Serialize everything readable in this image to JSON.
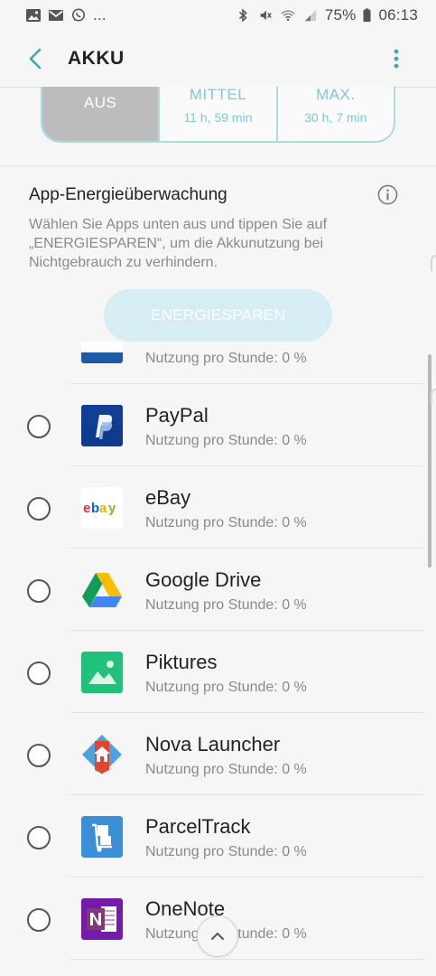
{
  "status_bar": {
    "left_icons": [
      "gallery-icon",
      "gmail-icon",
      "whatsapp-icon"
    ],
    "ellipsis": "...",
    "right_icons": [
      "bluetooth-icon",
      "mute-icon",
      "wifi-icon",
      "signal-icon",
      "battery-icon"
    ],
    "battery_percent": "75%",
    "time": "06:13"
  },
  "header": {
    "title": "AKKU"
  },
  "power_modes": [
    {
      "label": "AUS",
      "sub": "",
      "selected": true
    },
    {
      "label": "MITTEL",
      "sub": "11 h, 59 min",
      "selected": false
    },
    {
      "label": "MAX.",
      "sub": "30 h, 7 min",
      "selected": false
    }
  ],
  "monitoring": {
    "title": "App-Energieüberwachung",
    "description": "Wählen Sie Apps unten aus und tippen Sie auf „ENERGIESPAREN“, um die Akkunutzung bei Nichtgebrauch zu verhindern.",
    "button_label": "ENERGIESPAREN"
  },
  "apps": [
    {
      "name": "",
      "usage": "Nutzung pro Stunde: 0 %",
      "icon": "partial-app-icon"
    },
    {
      "name": "PayPal",
      "usage": "Nutzung pro Stunde: 0 %",
      "icon": "paypal-icon"
    },
    {
      "name": "eBay",
      "usage": "Nutzung pro Stunde: 0 %",
      "icon": "ebay-icon"
    },
    {
      "name": "Google Drive",
      "usage": "Nutzung pro Stunde: 0 %",
      "icon": "google-drive-icon"
    },
    {
      "name": "Piktures",
      "usage": "Nutzung pro Stunde: 0 %",
      "icon": "piktures-icon"
    },
    {
      "name": "Nova Launcher",
      "usage": "Nutzung pro Stunde: 0 %",
      "icon": "nova-launcher-icon"
    },
    {
      "name": "ParcelTrack",
      "usage": "Nutzung pro Stunde: 0 %",
      "icon": "parceltrack-icon"
    },
    {
      "name": "OneNote",
      "usage": "Nutzung pro Stunde: 0 %",
      "icon": "onenote-icon"
    }
  ],
  "colors": {
    "accent": "#3fa7b8",
    "mode_outline": "#a9dce3",
    "button_bg": "#d6edf3"
  }
}
